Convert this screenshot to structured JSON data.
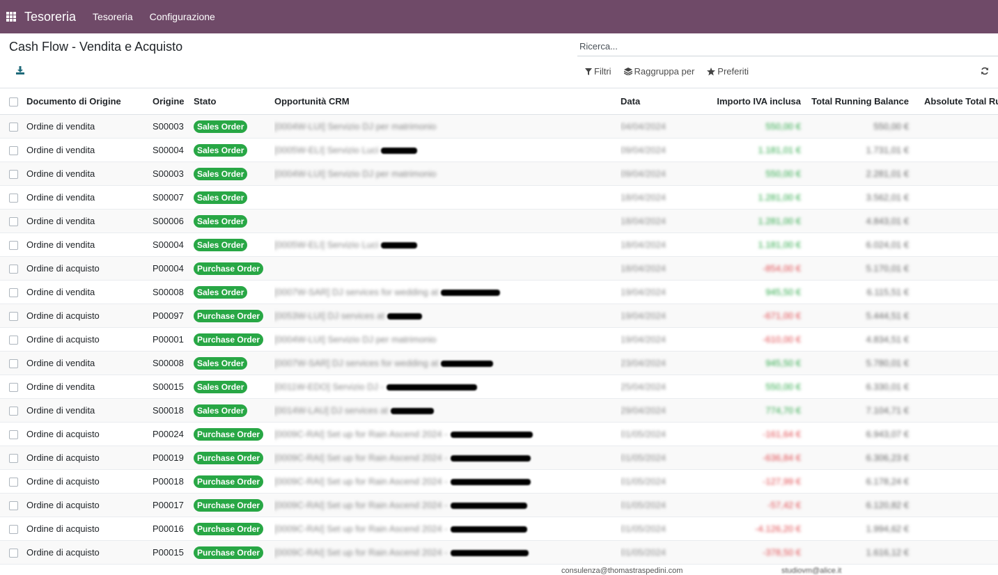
{
  "navbar": {
    "brand": "Tesoreria",
    "menu": [
      "Tesoreria",
      "Configurazione"
    ]
  },
  "page": {
    "title": "Cash Flow - Vendita e Acquisto"
  },
  "search": {
    "placeholder": "Ricerca..."
  },
  "toolbar": {
    "filters": "Filtri",
    "group_by": "Raggruppa per",
    "favorites": "Preferiti"
  },
  "table": {
    "columns": [
      "Documento di Origine",
      "Origine",
      "Stato",
      "Opportunità CRM",
      "Data",
      "Importo IVA inclusa",
      "Total Running Balance",
      "Absolute Total Ru"
    ],
    "rows": [
      {
        "doc": "Ordine di vendita",
        "origin": "S00003",
        "state": "Sales Order",
        "crm": "[0004W-LUI] Servizio DJ per matrimonio",
        "redact": 0,
        "date": "04/04/2024",
        "amount": "550,00 €",
        "sign": "pos",
        "balance": "550,00 €"
      },
      {
        "doc": "Ordine di vendita",
        "origin": "S00004",
        "state": "Sales Order",
        "crm": "[0005W-ELI] Servizio Luci",
        "redact": 52,
        "date": "09/04/2024",
        "amount": "1.181,01 €",
        "sign": "pos",
        "balance": "1.731,01 €"
      },
      {
        "doc": "Ordine di vendita",
        "origin": "S00003",
        "state": "Sales Order",
        "crm": "[0004W-LUI] Servizio DJ per matrimonio",
        "redact": 0,
        "date": "09/04/2024",
        "amount": "550,00 €",
        "sign": "pos",
        "balance": "2.281,01 €"
      },
      {
        "doc": "Ordine di vendita",
        "origin": "S00007",
        "state": "Sales Order",
        "crm": "",
        "redact": 0,
        "date": "18/04/2024",
        "amount": "1.281,00 €",
        "sign": "pos",
        "balance": "3.562,01 €"
      },
      {
        "doc": "Ordine di vendita",
        "origin": "S00006",
        "state": "Sales Order",
        "crm": "",
        "redact": 0,
        "date": "18/04/2024",
        "amount": "1.281,00 €",
        "sign": "pos",
        "balance": "4.843,01 €"
      },
      {
        "doc": "Ordine di vendita",
        "origin": "S00004",
        "state": "Sales Order",
        "crm": "[0005W-ELI] Servizio Luci",
        "redact": 52,
        "date": "18/04/2024",
        "amount": "1.181,00 €",
        "sign": "pos",
        "balance": "6.024,01 €"
      },
      {
        "doc": "Ordine di acquisto",
        "origin": "P00004",
        "state": "Purchase Order",
        "crm": "",
        "redact": 0,
        "date": "18/04/2024",
        "amount": "-854,00 €",
        "sign": "neg",
        "balance": "5.170,01 €"
      },
      {
        "doc": "Ordine di vendita",
        "origin": "S00008",
        "state": "Sales Order",
        "crm": "[0007W-SAR] DJ services for wedding at",
        "redact": 85,
        "date": "19/04/2024",
        "amount": "945,50 €",
        "sign": "pos",
        "balance": "6.115,51 €"
      },
      {
        "doc": "Ordine di acquisto",
        "origin": "P00097",
        "state": "Purchase Order",
        "crm": "[0053W-LUI] DJ services at",
        "redact": 50,
        "date": "19/04/2024",
        "amount": "-671,00 €",
        "sign": "neg",
        "balance": "5.444,51 €"
      },
      {
        "doc": "Ordine di acquisto",
        "origin": "P00001",
        "state": "Purchase Order",
        "crm": "[0004W-LUI] Servizio DJ per matrimonio",
        "redact": 0,
        "date": "19/04/2024",
        "amount": "-610,00 €",
        "sign": "neg",
        "balance": "4.834,51 €"
      },
      {
        "doc": "Ordine di vendita",
        "origin": "S00008",
        "state": "Sales Order",
        "crm": "[0007W-SAR] DJ services for wedding at",
        "redact": 75,
        "date": "23/04/2024",
        "amount": "945,50 €",
        "sign": "pos",
        "balance": "5.780,01 €"
      },
      {
        "doc": "Ordine di vendita",
        "origin": "S00015",
        "state": "Sales Order",
        "crm": "[0011W-EDO] Servizio DJ -",
        "redact": 130,
        "date": "25/04/2024",
        "amount": "550,00 €",
        "sign": "pos",
        "balance": "6.330,01 €"
      },
      {
        "doc": "Ordine di vendita",
        "origin": "S00018",
        "state": "Sales Order",
        "crm": "[0014W-LAU] DJ services at",
        "redact": 62,
        "date": "29/04/2024",
        "amount": "774,70 €",
        "sign": "pos",
        "balance": "7.104,71 €"
      },
      {
        "doc": "Ordine di acquisto",
        "origin": "P00024",
        "state": "Purchase Order",
        "crm": "[0009C-RAI] Set up for Rain Ascend 2024 -",
        "redact": 118,
        "date": "01/05/2024",
        "amount": "-161,64 €",
        "sign": "neg",
        "balance": "6.943,07 €"
      },
      {
        "doc": "Ordine di acquisto",
        "origin": "P00019",
        "state": "Purchase Order",
        "crm": "[0009C-RAI] Set up for Rain Ascend 2024 -",
        "redact": 115,
        "date": "01/05/2024",
        "amount": "-636,84 €",
        "sign": "neg",
        "balance": "6.306,23 €"
      },
      {
        "doc": "Ordine di acquisto",
        "origin": "P00018",
        "state": "Purchase Order",
        "crm": "[0009C-RAI] Set up for Rain Ascend 2024 -",
        "redact": 115,
        "date": "01/05/2024",
        "amount": "-127,99 €",
        "sign": "neg",
        "balance": "6.178,24 €"
      },
      {
        "doc": "Ordine di acquisto",
        "origin": "P00017",
        "state": "Purchase Order",
        "crm": "[0009C-RAI] Set up for Rain Ascend 2024 -",
        "redact": 110,
        "date": "01/05/2024",
        "amount": "-57,42 €",
        "sign": "neg",
        "balance": "6.120,82 €"
      },
      {
        "doc": "Ordine di acquisto",
        "origin": "P00016",
        "state": "Purchase Order",
        "crm": "[0009C-RAI] Set up for Rain Ascend 2024 -",
        "redact": 110,
        "date": "01/05/2024",
        "amount": "-4.126,20 €",
        "sign": "neg",
        "balance": "1.994,62 €"
      },
      {
        "doc": "Ordine di acquisto",
        "origin": "P00015",
        "state": "Purchase Order",
        "crm": "[0009C-RAI] Set up for Rain Ascend 2024 -",
        "redact": 112,
        "date": "01/05/2024",
        "amount": "-378,50 €",
        "sign": "neg",
        "balance": "1.616,12 €"
      }
    ]
  },
  "footer": {
    "email1": "consulenza@thomastraspedini.com",
    "email2": "studiovm@alice.it"
  },
  "colors": {
    "navbar": "#6f4a68",
    "badge": "#28a745",
    "positive": "#28a745",
    "negative": "#e0474c"
  }
}
